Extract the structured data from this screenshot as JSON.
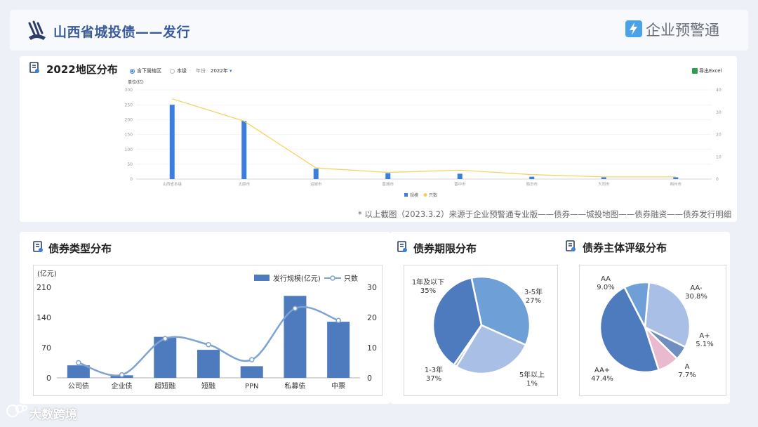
{
  "header": {
    "title": "山西省城投债——发行",
    "brand": "企业预警通"
  },
  "region": {
    "title": "2022地区分布",
    "controls": {
      "opt_all": "含下属辖区",
      "opt_self": "本级",
      "year_label": "年份",
      "year_value": "2022年",
      "export": "导出Excel"
    },
    "source_note": "* 以上截图（2023.3.2）来源于企业预警通专业版——债券——城投地图——债券融资——债券发行明细"
  },
  "type_section": {
    "title": "债券类型分布"
  },
  "term_section": {
    "title": "债券期限分布"
  },
  "rating_section": {
    "title": "债券主体评级分布"
  },
  "watermark": "大数跨境",
  "chart_data": [
    {
      "type": "bar",
      "title": "",
      "ylabel": "单位(亿)",
      "ylim": [
        0,
        300
      ],
      "y2lim": [
        0,
        40
      ],
      "yticks": [
        "0",
        "50",
        "100",
        "150",
        "200",
        "250",
        "300"
      ],
      "y2ticks": [
        "0",
        "10",
        "20",
        "30",
        "40"
      ],
      "categories": [
        "山西省本级",
        "太原市",
        "运城市",
        "晋城市",
        "晋中市",
        "临汾市",
        "大同市",
        "朔州市"
      ],
      "series": [
        {
          "name": "规模",
          "kind": "bar",
          "color": "#3a7fe0",
          "values": [
            250,
            196,
            35,
            20,
            18,
            8,
            6,
            6
          ]
        },
        {
          "name": "只数",
          "kind": "line",
          "color": "#f5d05a",
          "values": [
            36,
            26,
            5,
            3,
            4,
            2,
            1,
            1
          ]
        }
      ],
      "legend": "bottom"
    },
    {
      "type": "bar",
      "title": "",
      "ylabel": "(亿元)",
      "ylim": [
        0,
        210
      ],
      "y2lim": [
        0,
        30
      ],
      "yticks": [
        "0",
        "70",
        "140",
        "210"
      ],
      "y2ticks": [
        "0",
        "10",
        "20",
        "30"
      ],
      "categories": [
        "公司债",
        "企业债",
        "超短融",
        "短融",
        "PPN",
        "私募债",
        "中票"
      ],
      "series": [
        {
          "name": "发行规模(亿元)",
          "kind": "bar",
          "color": "#4e7bbd",
          "values": [
            29,
            6,
            95,
            65,
            27,
            190,
            130
          ]
        },
        {
          "name": "只数",
          "kind": "line",
          "color": "#7ea3cf",
          "values": [
            5,
            1,
            13,
            11,
            6,
            23,
            19
          ]
        }
      ],
      "legend": "top-right"
    },
    {
      "type": "pie",
      "title": "",
      "slices": [
        {
          "label": "1年及以下",
          "pct": "35%",
          "value": 35,
          "color": "#6e9fd6"
        },
        {
          "label": "3-5年",
          "pct": "27%",
          "value": 27,
          "color": "#a9bfe6"
        },
        {
          "label": "5年以上",
          "pct": "1%",
          "value": 1,
          "color": "#8fa8cc"
        },
        {
          "label": "1-3年",
          "pct": "37%",
          "value": 37,
          "color": "#4e7bbd"
        }
      ]
    },
    {
      "type": "pie",
      "title": "",
      "slices": [
        {
          "label": "AA-",
          "pct": "30.8%",
          "value": 30.8,
          "color": "#a9bfe6"
        },
        {
          "label": "A+",
          "pct": "5.1%",
          "value": 5.1,
          "color": "#6e8fbf"
        },
        {
          "label": "A",
          "pct": "7.7%",
          "value": 7.7,
          "color": "#e9b9cf"
        },
        {
          "label": "AA+",
          "pct": "47.4%",
          "value": 47.4,
          "color": "#4e7bbd"
        },
        {
          "label": "AA",
          "pct": "9.0%",
          "value": 9.0,
          "color": "#6e9fd6"
        }
      ]
    }
  ]
}
